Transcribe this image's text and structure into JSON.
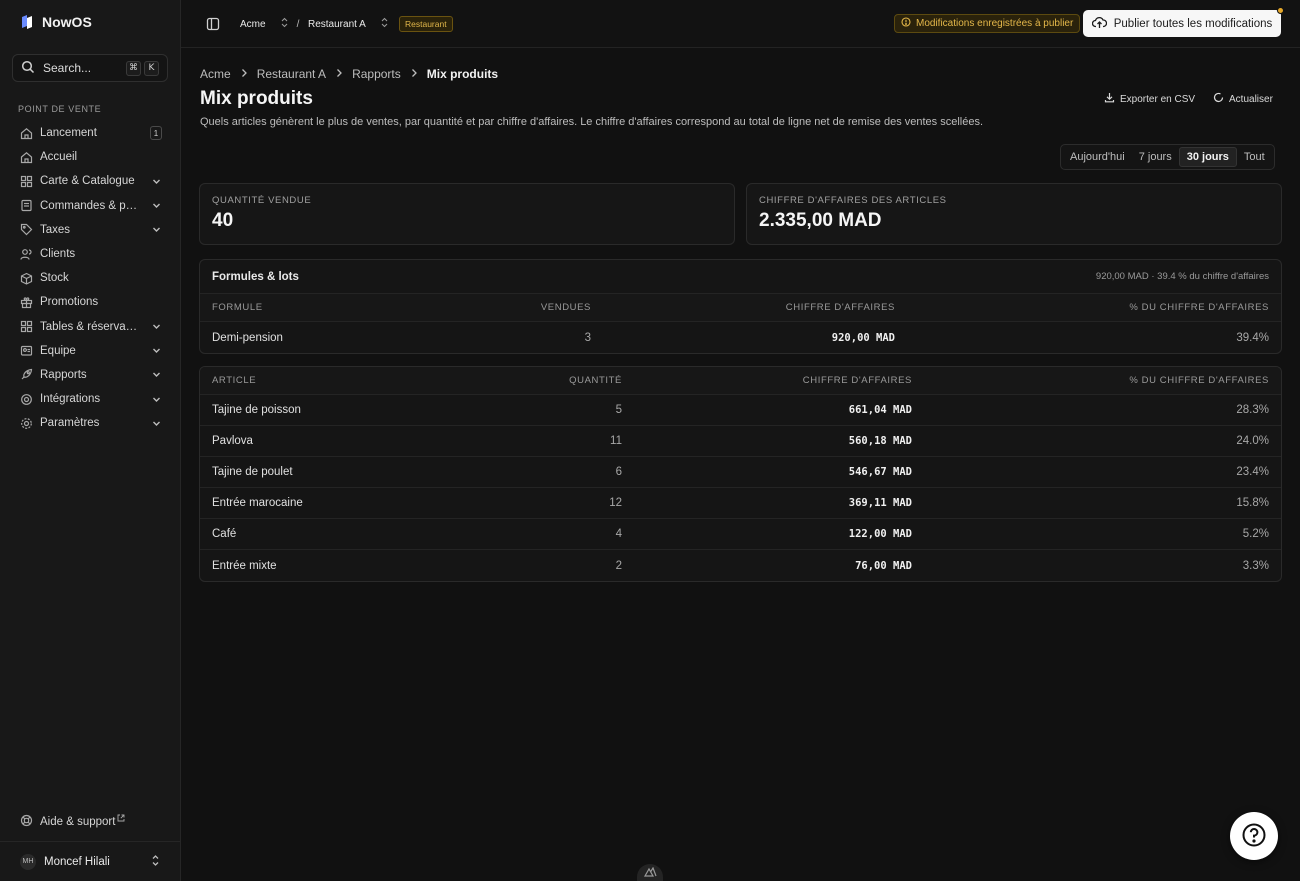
{
  "brand": {
    "name": "NowOS"
  },
  "search": {
    "placeholder": "Search...",
    "kbd1": "⌘",
    "kbd2": "K"
  },
  "sidebar": {
    "section": "POINT DE VENTE",
    "items": [
      {
        "label": "Lancement",
        "icon": "home-icon",
        "badge": "1"
      },
      {
        "label": "Accueil",
        "icon": "home-icon"
      },
      {
        "label": "Carte & Catalogue",
        "icon": "grid-icon",
        "expandable": true
      },
      {
        "label": "Commandes & pai…",
        "icon": "receipt-icon",
        "expandable": true
      },
      {
        "label": "Taxes",
        "icon": "tag-icon",
        "expandable": true
      },
      {
        "label": "Clients",
        "icon": "users-icon"
      },
      {
        "label": "Stock",
        "icon": "box-icon"
      },
      {
        "label": "Promotions",
        "icon": "gift-icon"
      },
      {
        "label": "Tables & réservati…",
        "icon": "grid-icon",
        "expandable": true
      },
      {
        "label": "Équipe",
        "icon": "id-card-icon",
        "expandable": true
      },
      {
        "label": "Rapports",
        "icon": "rocket-icon",
        "expandable": true
      },
      {
        "label": "Intégrations",
        "icon": "plug-icon",
        "expandable": true
      },
      {
        "label": "Paramètres",
        "icon": "gear-icon",
        "expandable": true
      }
    ],
    "help": "Aide & support",
    "user": {
      "initials": "MH",
      "name": "Moncef Hilali"
    }
  },
  "topbar": {
    "org": "Acme",
    "separator": "/",
    "location": "Restaurant A",
    "tag": "Restaurant",
    "pending": "Modifications enregistrées à publier",
    "publish": "Publier toutes les modifications"
  },
  "breadcrumb": {
    "c1": "Acme",
    "c2": "Restaurant A",
    "c3": "Rapports",
    "current": "Mix produits"
  },
  "page": {
    "title": "Mix produits",
    "description": "Quels articles génèrent le plus de ventes, par quantité et par chiffre d'affaires. Le chiffre d'affaires correspond au total de ligne net de remise des ventes scellées.",
    "export": "Exporter en CSV",
    "refresh": "Actualiser"
  },
  "range": {
    "tabs": [
      "Aujourd'hui",
      "7 jours",
      "30 jours",
      "Tout"
    ],
    "active": "30 jours"
  },
  "stats": {
    "qty_label": "QUANTITÉ VENDUE",
    "qty_value": "40",
    "rev_label": "CHIFFRE D'AFFAIRES DES ARTICLES",
    "rev_value": "2.335,00 MAD"
  },
  "bundles": {
    "title": "Formules & lots",
    "summary": "920,00 MAD · 39.4 % du chiffre d'affaires",
    "headers": [
      "FORMULE",
      "VENDUES",
      "CHIFFRE D'AFFAIRES",
      "% DU CHIFFRE D'AFFAIRES"
    ],
    "rows": [
      {
        "name": "Demi-pension",
        "sold": "3",
        "revenue": "920,00 MAD",
        "share": "39.4%"
      }
    ]
  },
  "articles": {
    "headers": [
      "ARTICLE",
      "QUANTITÉ",
      "CHIFFRE D'AFFAIRES",
      "% DU CHIFFRE D'AFFAIRES"
    ],
    "rows": [
      {
        "name": "Tajine de poisson",
        "qty": "5",
        "revenue": "661,04 MAD",
        "share": "28.3%"
      },
      {
        "name": "Pavlova",
        "qty": "11",
        "revenue": "560,18 MAD",
        "share": "24.0%"
      },
      {
        "name": "Tajine de poulet",
        "qty": "6",
        "revenue": "546,67 MAD",
        "share": "23.4%"
      },
      {
        "name": "Entrée marocaine",
        "qty": "12",
        "revenue": "369,11 MAD",
        "share": "15.8%"
      },
      {
        "name": "Café",
        "qty": "4",
        "revenue": "122,00 MAD",
        "share": "5.2%"
      },
      {
        "name": "Entrée mixte",
        "qty": "2",
        "revenue": "76,00 MAD",
        "share": "3.3%"
      }
    ]
  }
}
